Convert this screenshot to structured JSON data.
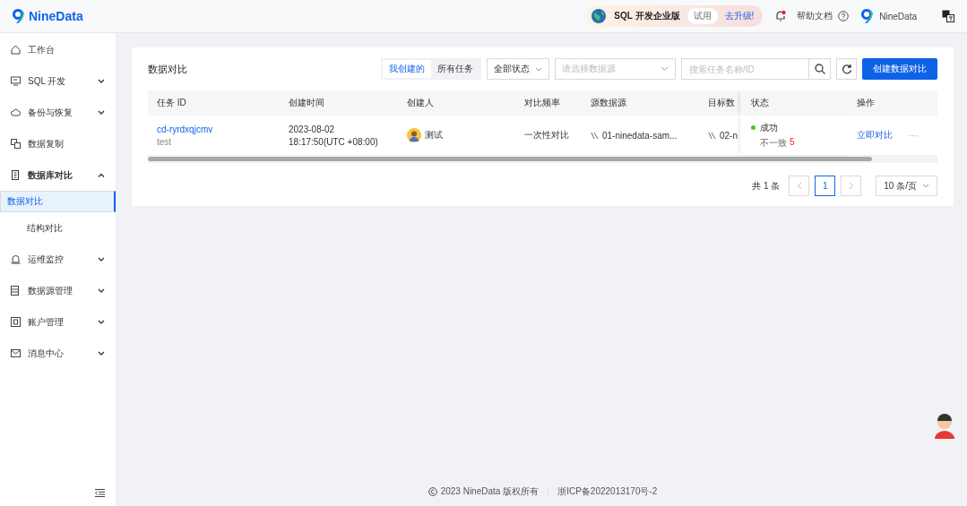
{
  "header": {
    "logo": "NineData",
    "promo": {
      "product": "SQL 开发企业版",
      "badge": "试用",
      "link": "去升级!"
    },
    "help": "帮助文档",
    "user": "NineData"
  },
  "sidebar": {
    "items": [
      {
        "label": "工作台",
        "expandable": false
      },
      {
        "label": "SQL 开发",
        "expandable": true,
        "expanded": false
      },
      {
        "label": "备份与恢复",
        "expandable": true,
        "expanded": false
      },
      {
        "label": "数据复制",
        "expandable": false
      },
      {
        "label": "数据库对比",
        "expandable": true,
        "expanded": true,
        "children": [
          {
            "label": "数据对比",
            "selected": true
          },
          {
            "label": "结构对比",
            "selected": false
          }
        ]
      },
      {
        "label": "运维监控",
        "expandable": true,
        "expanded": false
      },
      {
        "label": "数据源管理",
        "expandable": true,
        "expanded": false
      },
      {
        "label": "账户管理",
        "expandable": true,
        "expanded": false
      },
      {
        "label": "消息中心",
        "expandable": true,
        "expanded": false
      }
    ]
  },
  "card": {
    "title": "数据对比",
    "scope_tabs": [
      {
        "label": "我创建的",
        "selected": true
      },
      {
        "label": "所有任务",
        "selected": false
      }
    ],
    "status_filter": "全部状态",
    "source_select": {
      "placeholder": "请选择数据源"
    },
    "search": {
      "placeholder": "搜索任务名称/ID"
    },
    "create_button": "创建数据对比",
    "table": {
      "columns": [
        "任务 ID",
        "创建时间",
        "创建人",
        "对比频率",
        "源数据源",
        "目标数",
        "状态",
        "操作"
      ],
      "rows": [
        {
          "task_id": "cd-ryrdxqjcmv",
          "task_name": "test",
          "date": "2023-08-02",
          "time": "18:17:50(UTC +08:00)",
          "creator": "测试",
          "frequency": "一次性对比",
          "source": "01-ninedata-sam...",
          "target": "02-n",
          "status": "成功",
          "diff_label": "不一致",
          "diff_count": "5",
          "action": "立即对比",
          "more": "···"
        }
      ]
    },
    "pagination": {
      "total": "共 1 条",
      "pages": [
        {
          "label": "1",
          "selected": true
        }
      ],
      "page_size": "10 条/页"
    }
  },
  "footer": {
    "copyright": "2023 NineData 版权所有",
    "icp": "浙ICP备2022013170号-2"
  }
}
